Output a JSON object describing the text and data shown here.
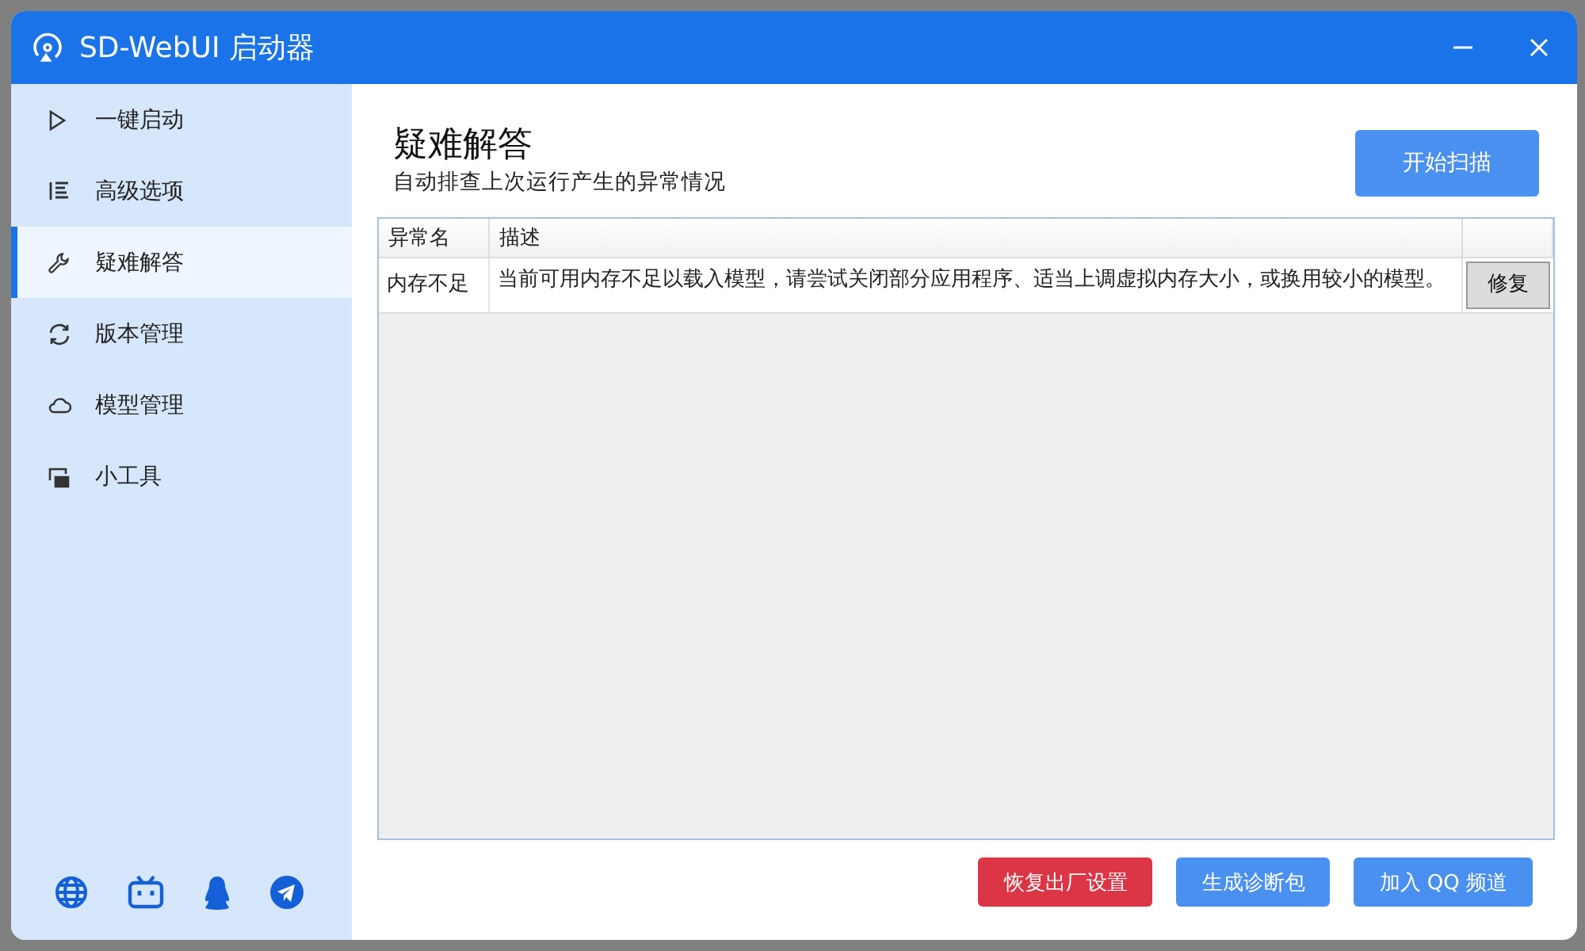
{
  "window": {
    "title": "SD-WebUI 启动器"
  },
  "sidebar": {
    "items": [
      {
        "label": "一键启动",
        "selected": false
      },
      {
        "label": "高级选项",
        "selected": false
      },
      {
        "label": "疑难解答",
        "selected": true
      },
      {
        "label": "版本管理",
        "selected": false
      },
      {
        "label": "模型管理",
        "selected": false
      },
      {
        "label": "小工具",
        "selected": false
      }
    ]
  },
  "page": {
    "title": "疑难解答",
    "subtitle": "自动排查上次运行产生的异常情况",
    "scan_button": "开始扫描"
  },
  "table": {
    "columns": [
      "异常名",
      "描述"
    ],
    "rows": [
      {
        "name": "内存不足",
        "description": "当前可用内存不足以载入模型，请尝试关闭部分应用程序、适当上调虚拟内存大小，或换用较小的模型。",
        "action": "修复"
      }
    ]
  },
  "buttons": [
    {
      "label": "恢复出厂设置",
      "kind": "danger"
    },
    {
      "label": "生成诊断包",
      "kind": "primary"
    },
    {
      "label": "加入 QQ 频道",
      "kind": "primary"
    }
  ]
}
